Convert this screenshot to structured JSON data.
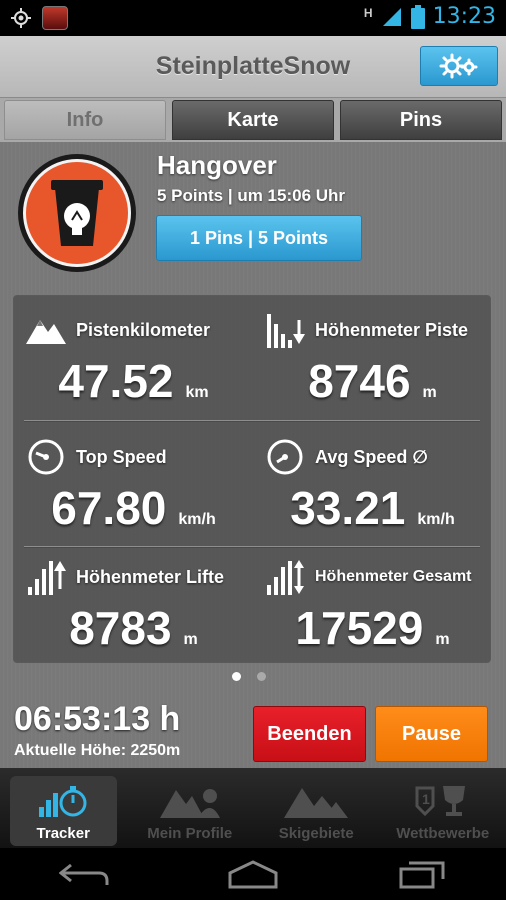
{
  "status_bar": {
    "time": "13:23",
    "network": "H"
  },
  "app": {
    "title": "SteinplatteSnow"
  },
  "tabs": [
    {
      "label": "Info",
      "active": true
    },
    {
      "label": "Karte",
      "active": false
    },
    {
      "label": "Pins",
      "active": false
    }
  ],
  "achievement": {
    "title": "Hangover",
    "subtitle": "5 Points | um 15:06 Uhr",
    "button_label": "1 Pins | 5 Points",
    "icon": "coffee-cup-icon"
  },
  "stats": [
    {
      "label": "Pistenkilometer",
      "value": "47.52",
      "unit": "km",
      "icon": "mountain-icon"
    },
    {
      "label": "Höhenmeter Piste",
      "value": "8746",
      "unit": "m",
      "icon": "descent-bars-icon"
    },
    {
      "label": "Top Speed",
      "value": "67.80",
      "unit": "km/h",
      "icon": "speedometer-icon"
    },
    {
      "label": "Avg Speed ∅",
      "value": "33.21",
      "unit": "km/h",
      "icon": "speedometer-icon"
    },
    {
      "label": "Höhenmeter Lifte",
      "value": "8783",
      "unit": "m",
      "icon": "ascent-bars-icon"
    },
    {
      "label": "Höhenmeter Gesamt",
      "value": "17529",
      "unit": "m",
      "icon": "updown-bars-icon"
    }
  ],
  "pager": {
    "pages": 2,
    "current": 1
  },
  "session": {
    "timer": "06:53:13 h",
    "altitude": "Aktuelle Höhe: 2250m",
    "stop_label": "Beenden",
    "pause_label": "Pause"
  },
  "bottom_nav": [
    {
      "label": "Tracker",
      "active": true
    },
    {
      "label": "Mein Profile",
      "active": false
    },
    {
      "label": "Skigebiete",
      "active": false
    },
    {
      "label": "Wettbewerbe",
      "active": false
    }
  ],
  "colors": {
    "accent_blue": "#33b5e5",
    "stop_red": "#e8202a",
    "pause_orange": "#f07400",
    "badge_orange": "#e8562c"
  }
}
